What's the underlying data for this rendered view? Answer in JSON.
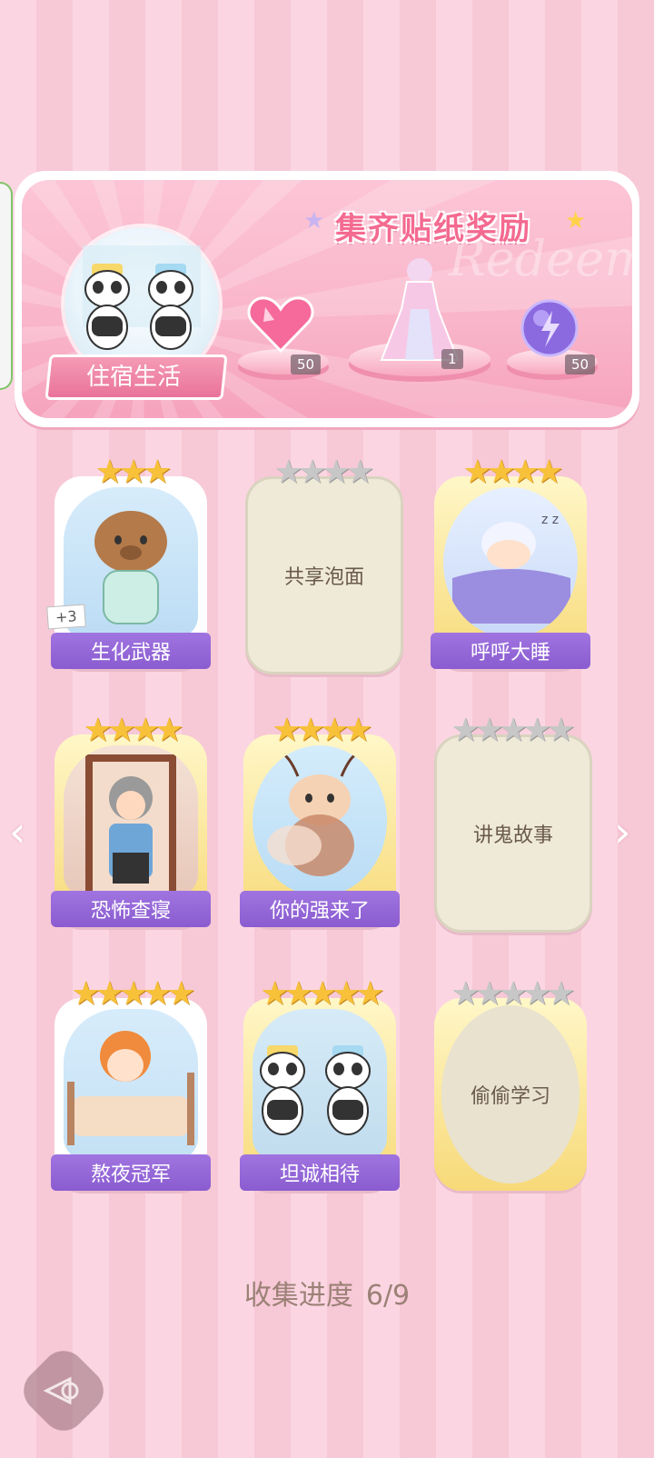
{
  "banner": {
    "title": "集齐贴纸奖励",
    "watermark": "Redeem",
    "theme_label": "住宿生活",
    "rewards": [
      {
        "name": "heart-gem-icon",
        "count": "50"
      },
      {
        "name": "dress-outfit-icon",
        "count": "1"
      },
      {
        "name": "energy-orb-icon",
        "count": "50"
      }
    ]
  },
  "cards": [
    {
      "title": "生化武器",
      "stars": 3,
      "max_stars": 3,
      "locked": false,
      "extra": "+3",
      "art": "capybara-pajama-icon"
    },
    {
      "title": "共享泡面",
      "stars": 0,
      "max_stars": 4,
      "locked": true,
      "art": ""
    },
    {
      "title": "呼呼大睡",
      "stars": 4,
      "max_stars": 4,
      "locked": false,
      "art": "sleeping-boy-icon"
    },
    {
      "title": "恐怖查寝",
      "stars": 4,
      "max_stars": 4,
      "locked": false,
      "art": "dorm-auntie-icon"
    },
    {
      "title": "你的强来了",
      "stars": 4,
      "max_stars": 4,
      "locked": false,
      "art": "cockroach-icon"
    },
    {
      "title": "讲鬼故事",
      "stars": 0,
      "max_stars": 5,
      "locked": true,
      "art": ""
    },
    {
      "title": "熬夜冠军",
      "stars": 5,
      "max_stars": 5,
      "locked": false,
      "art": "phone-in-bed-icon"
    },
    {
      "title": "坦诚相待",
      "stars": 5,
      "max_stars": 5,
      "locked": false,
      "art": "panda-bath-icon"
    },
    {
      "title": "偷偷学习",
      "stars": 0,
      "max_stars": 5,
      "locked": true,
      "art": ""
    }
  ],
  "progress": {
    "label": "收集进度",
    "value": "6/9"
  },
  "colors": {
    "accent": "#8a5cd0",
    "gold": "#f7c23a",
    "pink": "#f46a90"
  }
}
